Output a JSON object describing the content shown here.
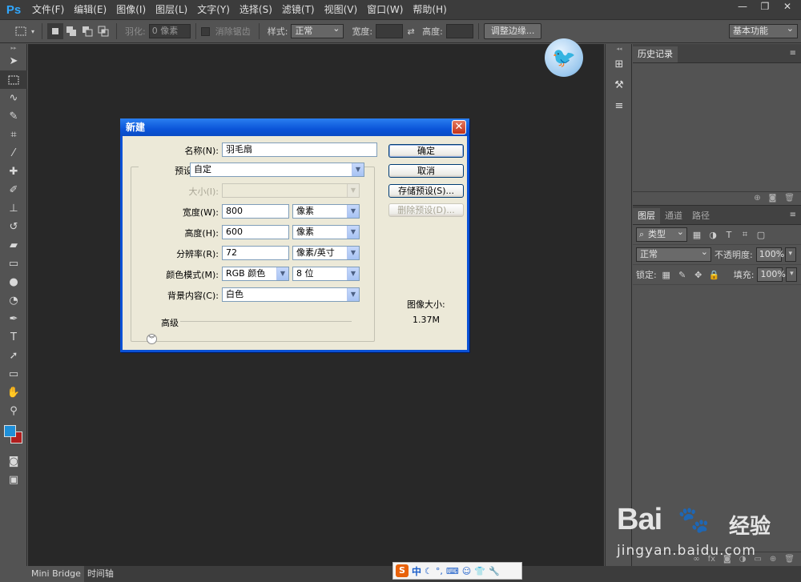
{
  "app": {
    "logo": "Ps",
    "menu": [
      "文件(F)",
      "编辑(E)",
      "图像(I)",
      "图层(L)",
      "文字(Y)",
      "选择(S)",
      "滤镜(T)",
      "视图(V)",
      "窗口(W)",
      "帮助(H)"
    ],
    "window_controls": {
      "minimize": "—",
      "restore": "❐",
      "close": "✕"
    }
  },
  "options": {
    "feather_label": "羽化:",
    "feather_value": "0 像素",
    "antialias_label": "消除锯齿",
    "style_label": "样式:",
    "style_value": "正常",
    "width_label": "宽度:",
    "height_label": "高度:",
    "refine_edge_button": "调整边缘...",
    "workspace": "基本功能"
  },
  "tools": [
    "move-icon",
    "marquee-icon",
    "lasso-icon",
    "quick-select-icon",
    "crop-icon",
    "eyedropper-icon",
    "healing-icon",
    "brush-icon",
    "stamp-icon",
    "history-brush-icon",
    "eraser-icon",
    "gradient-icon",
    "blur-icon",
    "dodge-icon",
    "pen-icon",
    "type-icon",
    "path-select-icon",
    "shape-icon",
    "hand-icon",
    "zoom-icon"
  ],
  "colors": {
    "foreground": "#1e8fd8",
    "background": "#b01e1e",
    "titlebar": "#0b55d9"
  },
  "history_panel": {
    "tab": "历史记录"
  },
  "layers_panel": {
    "tabs": [
      "图层",
      "通道",
      "路径"
    ],
    "filter_kind": "类型",
    "blend_mode": "正常",
    "opacity_label": "不透明度:",
    "opacity_value": "100%",
    "lock_label": "锁定:",
    "fill_label": "填充:",
    "fill_value": "100%"
  },
  "statusbar": {
    "tabs": [
      "Mini Bridge",
      "时间轴"
    ]
  },
  "ime": {
    "logo": "S",
    "mode": "中"
  },
  "watermark": {
    "brand": "Bai",
    "suffix": "经验",
    "url": "jingyan.baidu.com"
  },
  "dialog": {
    "title": "新建",
    "close": "✕",
    "name_label": "名称(N):",
    "name_value": "羽毛扇",
    "preset_label": "预设(P):",
    "preset_value": "自定",
    "size_label": "大小(I):",
    "width_label": "宽度(W):",
    "width_value": "800",
    "width_unit": "像素",
    "height_label": "高度(H):",
    "height_value": "600",
    "height_unit": "像素",
    "resolution_label": "分辨率(R):",
    "resolution_value": "72",
    "resolution_unit": "像素/英寸",
    "color_mode_label": "颜色模式(M):",
    "color_mode_value": "RGB 颜色",
    "bit_depth_value": "8 位",
    "background_label": "背景内容(C):",
    "background_value": "白色",
    "advanced_label": "高级",
    "image_size_label": "图像大小:",
    "image_size_value": "1.37M",
    "ok_button": "确定",
    "cancel_button": "取消",
    "save_preset_button": "存储预设(S)...",
    "delete_preset_button": "删除预设(D)..."
  }
}
